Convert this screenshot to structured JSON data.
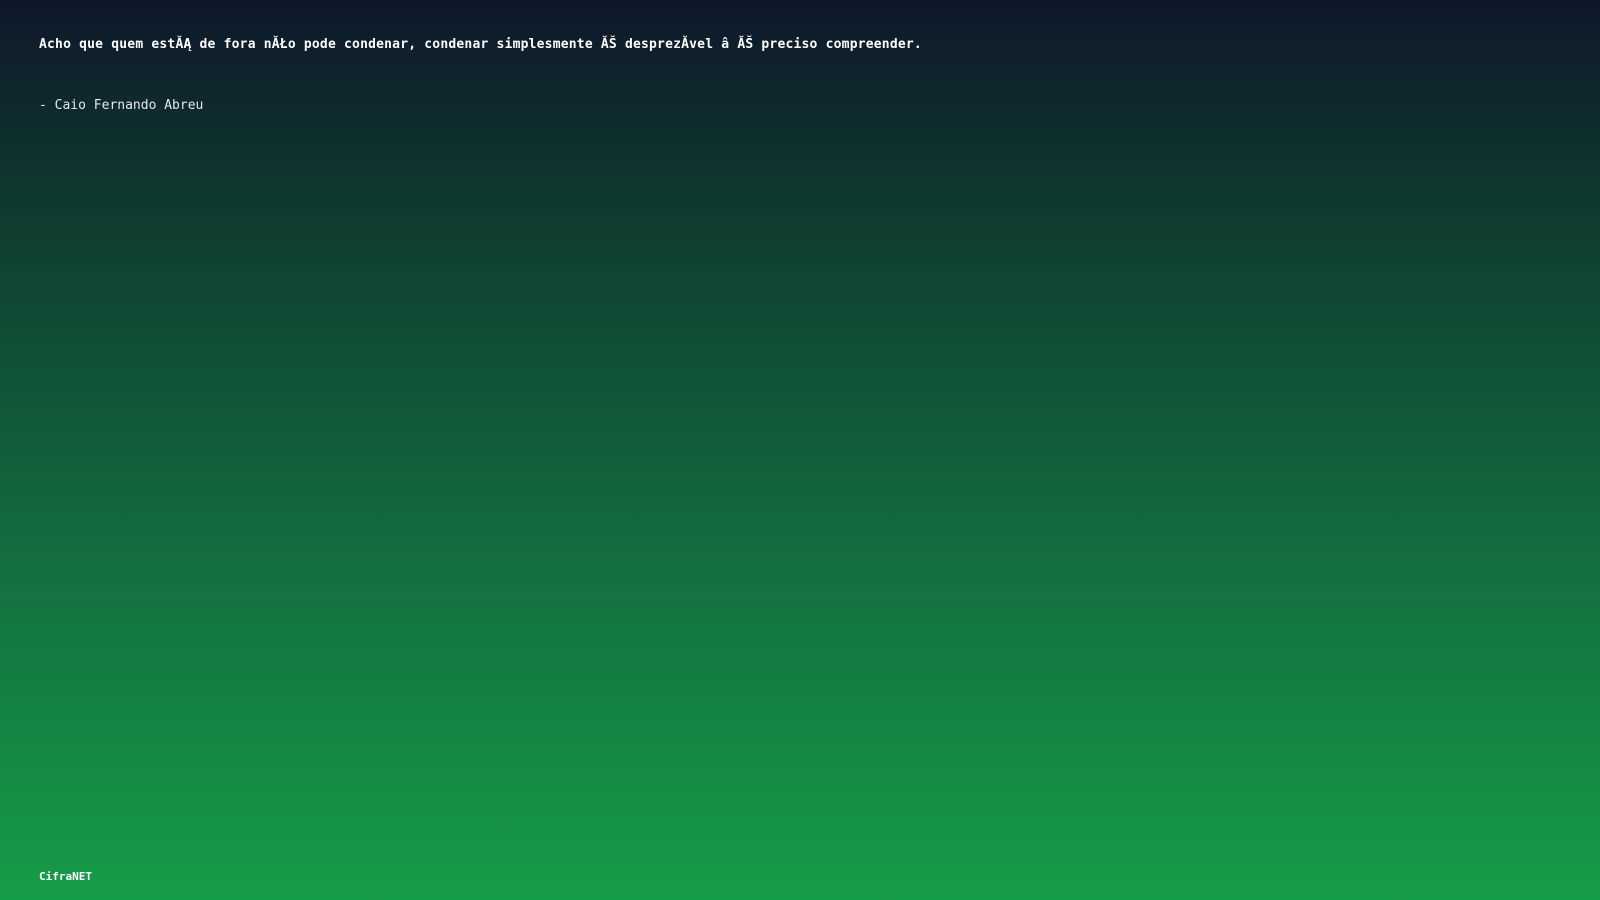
{
  "quote": {
    "text": "Acho que quem estĂĄ de fora nĂŁo pode condenar, condenar simplesmente ĂŠ desprezĂ­vel â   ĂŠ preciso compreender.",
    "author": "- Caio Fernando Abreu"
  },
  "footer": {
    "brand": "CifraNET"
  }
}
